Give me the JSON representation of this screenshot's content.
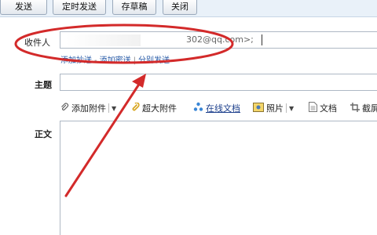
{
  "toolbar": {
    "send_label": "发送",
    "timed_send_label": "定时发送",
    "save_draft_label": "存草稿",
    "close_label": "关闭"
  },
  "recipient": {
    "label": "收件人",
    "value": "302@qq.com>;",
    "links": {
      "add_cc": "添加抄送",
      "add_bcc": "添加密送",
      "separate_send": "分别发送"
    }
  },
  "subject": {
    "label": "主题",
    "value": ""
  },
  "attachments": {
    "add_attachment": "添加附件",
    "large_attachment": "超大附件",
    "online_doc": "在线文档",
    "photo": "照片",
    "document": "文档",
    "screenshot": "截屏"
  },
  "body": {
    "label": "正文",
    "value": ""
  },
  "annotation": {
    "color": "#d32a2a"
  }
}
